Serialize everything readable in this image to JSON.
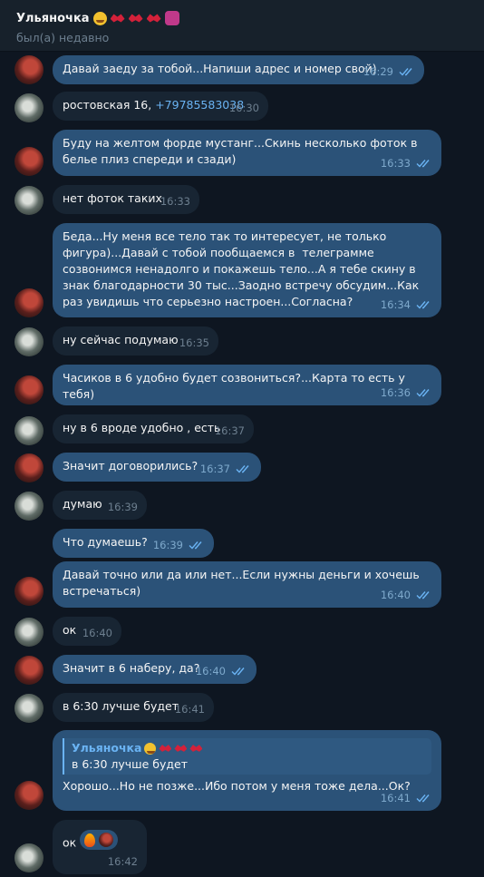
{
  "header": {
    "contact_name": "Ульяночка",
    "status": "был(а) недавно",
    "name_emojis": [
      "smiling-face-emoji",
      "kiss-mark-emoji",
      "kiss-mark-emoji",
      "kiss-mark-emoji",
      "sticker-emoji"
    ]
  },
  "messages": [
    {
      "dir": "out",
      "text": "Давай заеду за тобой...Напиши адрес и номер свой)",
      "time": "16:29",
      "read": true
    },
    {
      "dir": "in",
      "text": "ростовская 16, ",
      "link": "+79785583038",
      "time": "16:30"
    },
    {
      "dir": "out",
      "text": "Буду на желтом форде мустанг...Скинь несколько фоток в белье плиз спереди и сзади)",
      "time": "16:33",
      "read": true
    },
    {
      "dir": "in",
      "text": "нет фоток таких",
      "time": "16:33"
    },
    {
      "dir": "out",
      "text": "Беда...Ну меня все тело так то интересует, не только фигура)...Давай с тобой пообщаемся в  телеграмме созвонимся ненадолго и покажешь тело...А я тебе скину в знак благодарности 30 тыс...Заодно встречу обсудим...Как раз увидишь что серьезно настроен...Согласна?",
      "time": "16:34",
      "read": true
    },
    {
      "dir": "in",
      "text": "ну сейчас подумаю",
      "time": "16:35"
    },
    {
      "dir": "out",
      "text": "Часиков в 6 удобно будет созвониться?...Карта то есть у тебя)",
      "time": "16:36",
      "read": true
    },
    {
      "dir": "in",
      "text": "ну в 6 вроде удобно , есть",
      "time": "16:37"
    },
    {
      "dir": "out",
      "text": "Значит договорились?",
      "time": "16:37",
      "read": true
    },
    {
      "dir": "in",
      "text": "думаю",
      "time": "16:39"
    },
    {
      "dir": "out",
      "text": "Что думаешь?",
      "time": "16:39",
      "read": true
    },
    {
      "dir": "out",
      "text": "Давай точно или да или нет...Если нужны деньги и хочешь встречаться)",
      "time": "16:40",
      "read": true
    },
    {
      "dir": "in",
      "text": "ок",
      "time": "16:40"
    },
    {
      "dir": "out",
      "text": "Значит в 6 наберу, да?",
      "time": "16:40",
      "read": true
    },
    {
      "dir": "in",
      "text": "в 6:30 лучше будет",
      "time": "16:41"
    },
    {
      "dir": "out",
      "reply_name": "Ульяночка",
      "reply_text": "в 6:30 лучше будет",
      "text": "Хорошо...Но не позже...Ибо потом у меня тоже дела...Ок?",
      "time": "16:41",
      "read": true
    },
    {
      "dir": "in",
      "text": "ок",
      "time": "16:42",
      "reactions": [
        "fire-emoji",
        "reactor-avatar"
      ]
    }
  ],
  "colors": {
    "background": "#0e1621",
    "header": "#17212b",
    "outgoing_bubble": "#2b5278",
    "incoming_bubble": "#182533",
    "accent": "#6ab3f3"
  }
}
